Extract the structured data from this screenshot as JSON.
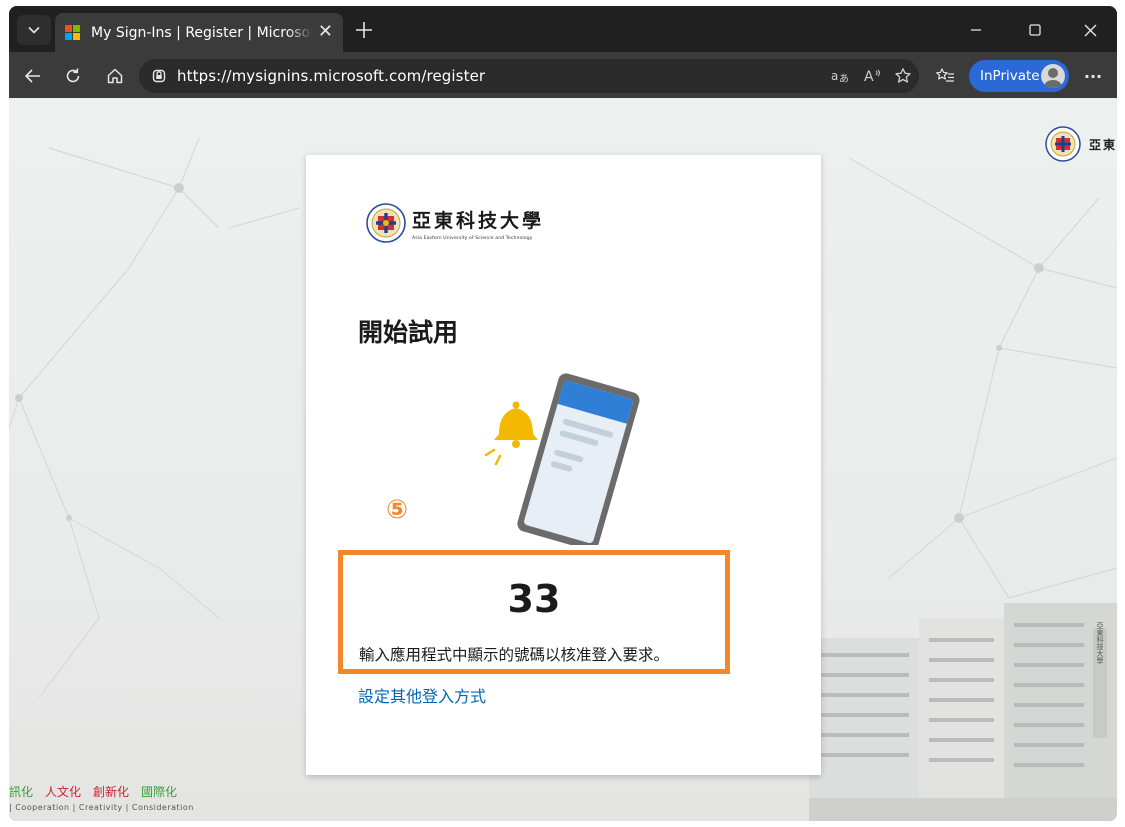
{
  "browser": {
    "tab_title": "My Sign-Ins | Register | Microsoft.com",
    "tab_close": "✕",
    "url": "https://mysignins.microsoft.com/register",
    "inprivate_label": "InPrivate",
    "more_label": "···"
  },
  "background": {
    "corner_logo_text": "亞東",
    "slogan": [
      "訊化",
      "人文化",
      "創新化",
      "國際化"
    ],
    "slogan_en": "| Cooperation | Creativity | Consideration",
    "building_sign": "亞東科技大學"
  },
  "card": {
    "university_name_cn": "亞東科技大學",
    "university_name_en": "Asia Eastern University of Science and Technology",
    "title": "開始試用",
    "step_marker": "⑤",
    "number": "33",
    "instruction": "輸入應用程式中顯示的號碼以核准登入要求。",
    "other_method_link": "設定其他登入方式"
  },
  "colors": {
    "highlight": "#f2872e",
    "link": "#0067b8",
    "inprivate": "#2a69d6",
    "bell": "#f5b800",
    "phone_header": "#2f7fd6"
  }
}
